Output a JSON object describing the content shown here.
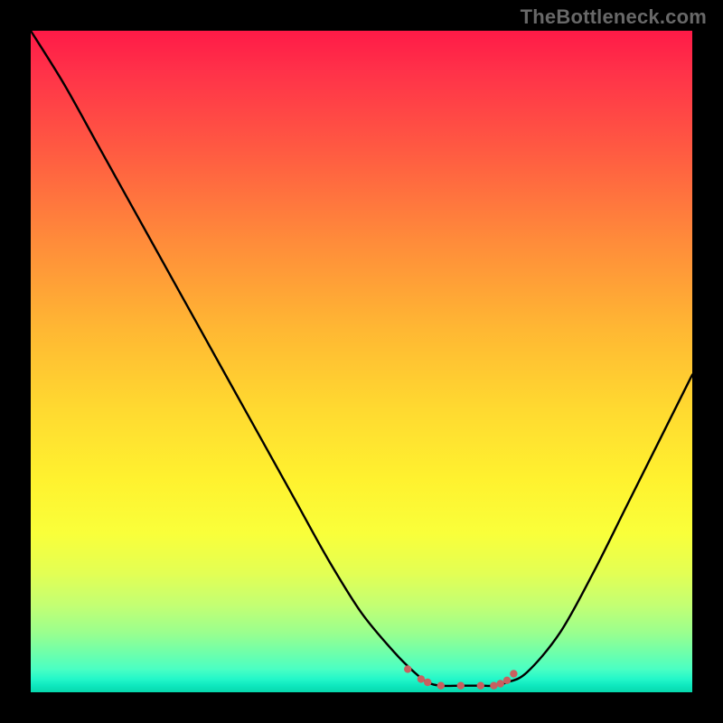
{
  "watermark": "TheBottleneck.com",
  "chart_data": {
    "type": "line",
    "title": "",
    "xlabel": "",
    "ylabel": "",
    "xlim": [
      0,
      100
    ],
    "ylim": [
      0,
      100
    ],
    "grid": false,
    "legend": "none",
    "annotations": [],
    "x": [
      0,
      5,
      10,
      15,
      20,
      25,
      30,
      35,
      40,
      45,
      50,
      55,
      58,
      60,
      62,
      65,
      68,
      70,
      72,
      75,
      80,
      85,
      90,
      95,
      100
    ],
    "values": [
      100,
      92,
      83,
      74,
      65,
      56,
      47,
      38,
      29,
      20,
      12,
      6,
      3,
      1.5,
      1,
      1,
      1,
      1,
      1.5,
      3,
      9,
      18,
      28,
      38,
      48
    ],
    "curve_color": "#000000",
    "background": "rainbow-vertical-gradient",
    "markers": {
      "color": "#c86060",
      "points_x": [
        57,
        59,
        60,
        62,
        65,
        68,
        70,
        71,
        72,
        73
      ],
      "points_y": [
        3.5,
        2,
        1.5,
        1,
        1,
        1,
        1,
        1.3,
        1.8,
        2.8
      ]
    }
  }
}
